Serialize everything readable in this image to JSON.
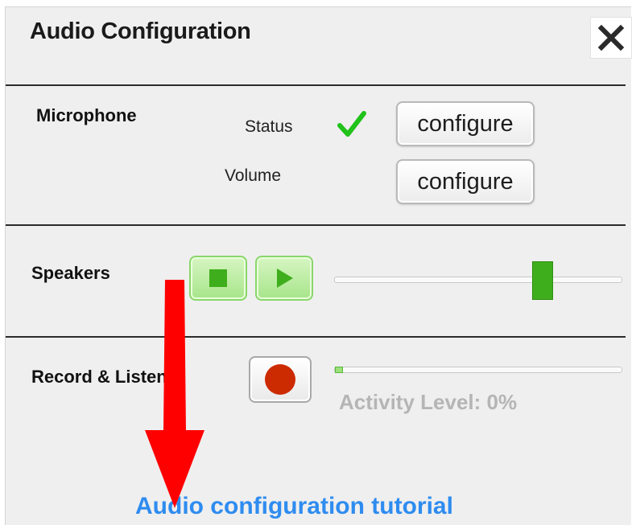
{
  "dialog": {
    "title": "Audio Configuration"
  },
  "microphone": {
    "label": "Microphone",
    "status_label": "Status",
    "status_ok": true,
    "volume_label": "Volume",
    "status_configure": "configure",
    "volume_configure": "configure"
  },
  "speakers": {
    "label": "Speakers",
    "volume_level": 0.74
  },
  "record": {
    "label": "Record & Listen",
    "activity_text": "Activity Level: 0%",
    "activity_level": 0
  },
  "tutorial_link": "Audio configuration tutorial",
  "colors": {
    "accent_green": "#3fae1c",
    "check_green": "#21c21a",
    "record_red": "#cc2a00",
    "link_blue": "#2e8cf0",
    "annotation_red": "#ff0000"
  },
  "icons": {
    "close": "close-icon",
    "status": "checkmark-icon",
    "stop": "stop-icon",
    "play": "play-icon",
    "record": "record-icon",
    "annotation": "red-arrow-annotation"
  }
}
